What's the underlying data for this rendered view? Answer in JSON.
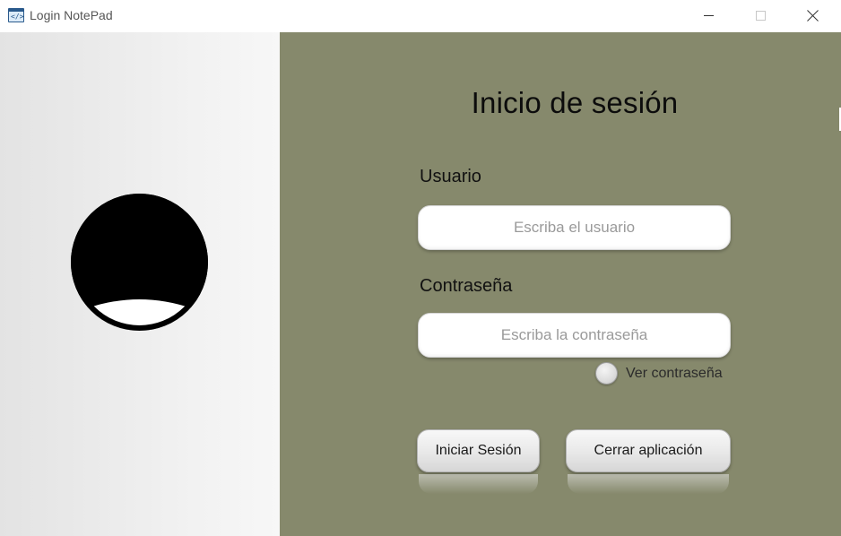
{
  "window": {
    "title": "Login NotePad",
    "icon": "code-window-icon",
    "icon_glyph": "</>"
  },
  "login": {
    "heading": "Inicio de sesión",
    "user_label": "Usuario",
    "user_placeholder": "Escriba el usuario",
    "password_label": "Contraseña",
    "password_placeholder": "Escriba la contraseña",
    "show_password_label": "Ver contraseña",
    "login_button": "Iniciar Sesión",
    "exit_button": "Cerrar aplicación"
  },
  "colors": {
    "right_panel": "#86896c",
    "left_panel": "#efefef",
    "avatar": "#000000"
  }
}
